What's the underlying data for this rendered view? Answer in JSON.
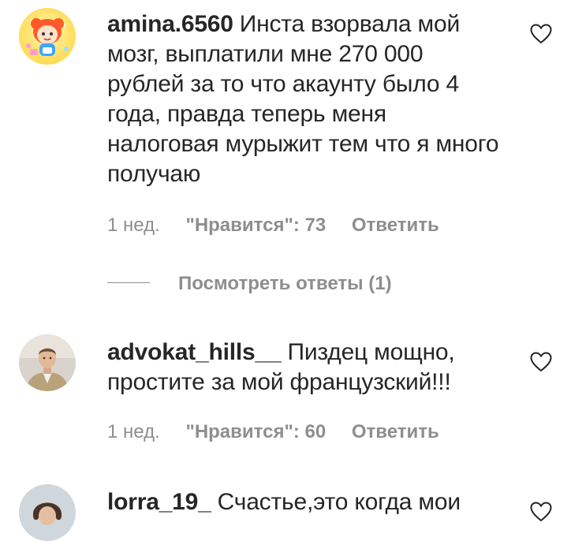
{
  "comments": [
    {
      "username": "amina.6560",
      "text": "Инста взорвала мой мозг, выплатили мне 270 000 рублей за то что акаунту было 4 года, правда теперь меня налоговая мурыжит тем что я много получаю",
      "time": "1 нед.",
      "likes": "\"Нравится\": 73",
      "reply_label": "Ответить",
      "avatar_icon": "cartoon-avatar-icon"
    },
    {
      "username": "advokat_hills__",
      "text": "Пиздец мощно, простите за мой французский!!!",
      "time": "1 нед.",
      "likes": "\"Нравится\": 60",
      "reply_label": "Ответить",
      "avatar_icon": "person-photo-avatar"
    },
    {
      "username": "lorra_19_",
      "text": "Счастье,это когда мои",
      "avatar_icon": "person-photo-avatar"
    }
  ],
  "view_replies": "Посмотреть ответы (1)",
  "colors": {
    "text": "#262626",
    "meta": "#8e8e8e",
    "background": "#ffffff"
  },
  "icons": {
    "like": "heart-outline-icon"
  }
}
